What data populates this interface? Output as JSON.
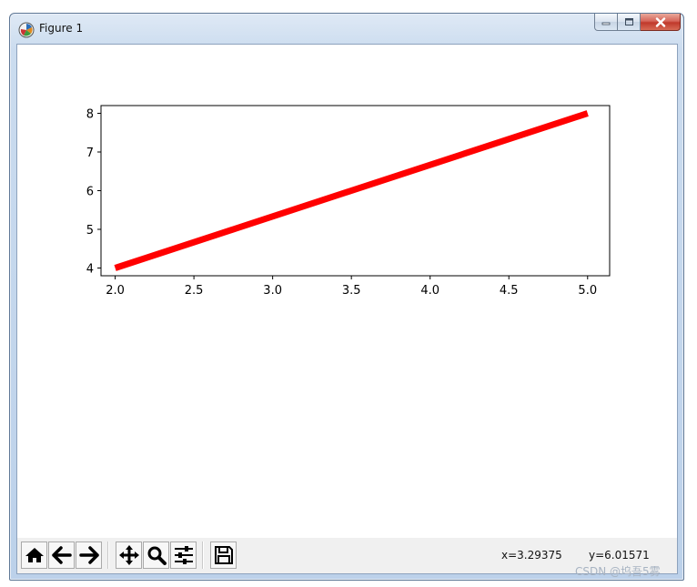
{
  "window": {
    "title": "Figure 1"
  },
  "icons": {
    "app": "matplotlib-figure-icon",
    "minimize": "minimize-icon",
    "maximize": "maximize-icon",
    "close": "close-icon"
  },
  "toolbar": {
    "buttons": [
      {
        "name": "home-button",
        "icon": "home-icon"
      },
      {
        "name": "back-button",
        "icon": "arrow-left-icon"
      },
      {
        "name": "forward-button",
        "icon": "arrow-right-icon"
      },
      {
        "name": "pan-button",
        "icon": "move-arrows-icon"
      },
      {
        "name": "zoom-button",
        "icon": "magnifier-icon"
      },
      {
        "name": "subplots-button",
        "icon": "sliders-icon"
      },
      {
        "name": "save-button",
        "icon": "floppy-disk-icon"
      }
    ],
    "coord_x": "x=3.29375",
    "coord_y": "y=6.01571"
  },
  "watermark": "CSDN @坞吾5雾",
  "chart_data": {
    "type": "line",
    "title": "",
    "xlabel": "",
    "ylabel": "",
    "xlim": [
      1.91,
      5.14
    ],
    "ylim": [
      3.8,
      8.2
    ],
    "xticks": [
      2.0,
      2.5,
      3.0,
      3.5,
      4.0,
      4.5,
      5.0
    ],
    "xtick_labels": [
      "2.0",
      "2.5",
      "3.0",
      "3.5",
      "4.0",
      "4.5",
      "5.0"
    ],
    "yticks": [
      4,
      5,
      6,
      7,
      8
    ],
    "ytick_labels": [
      "4",
      "5",
      "6",
      "7",
      "8"
    ],
    "grid": false,
    "legend": false,
    "series": [
      {
        "x": [
          2.0,
          5.0
        ],
        "y": [
          4,
          8
        ],
        "color": "#ff0000"
      }
    ]
  }
}
